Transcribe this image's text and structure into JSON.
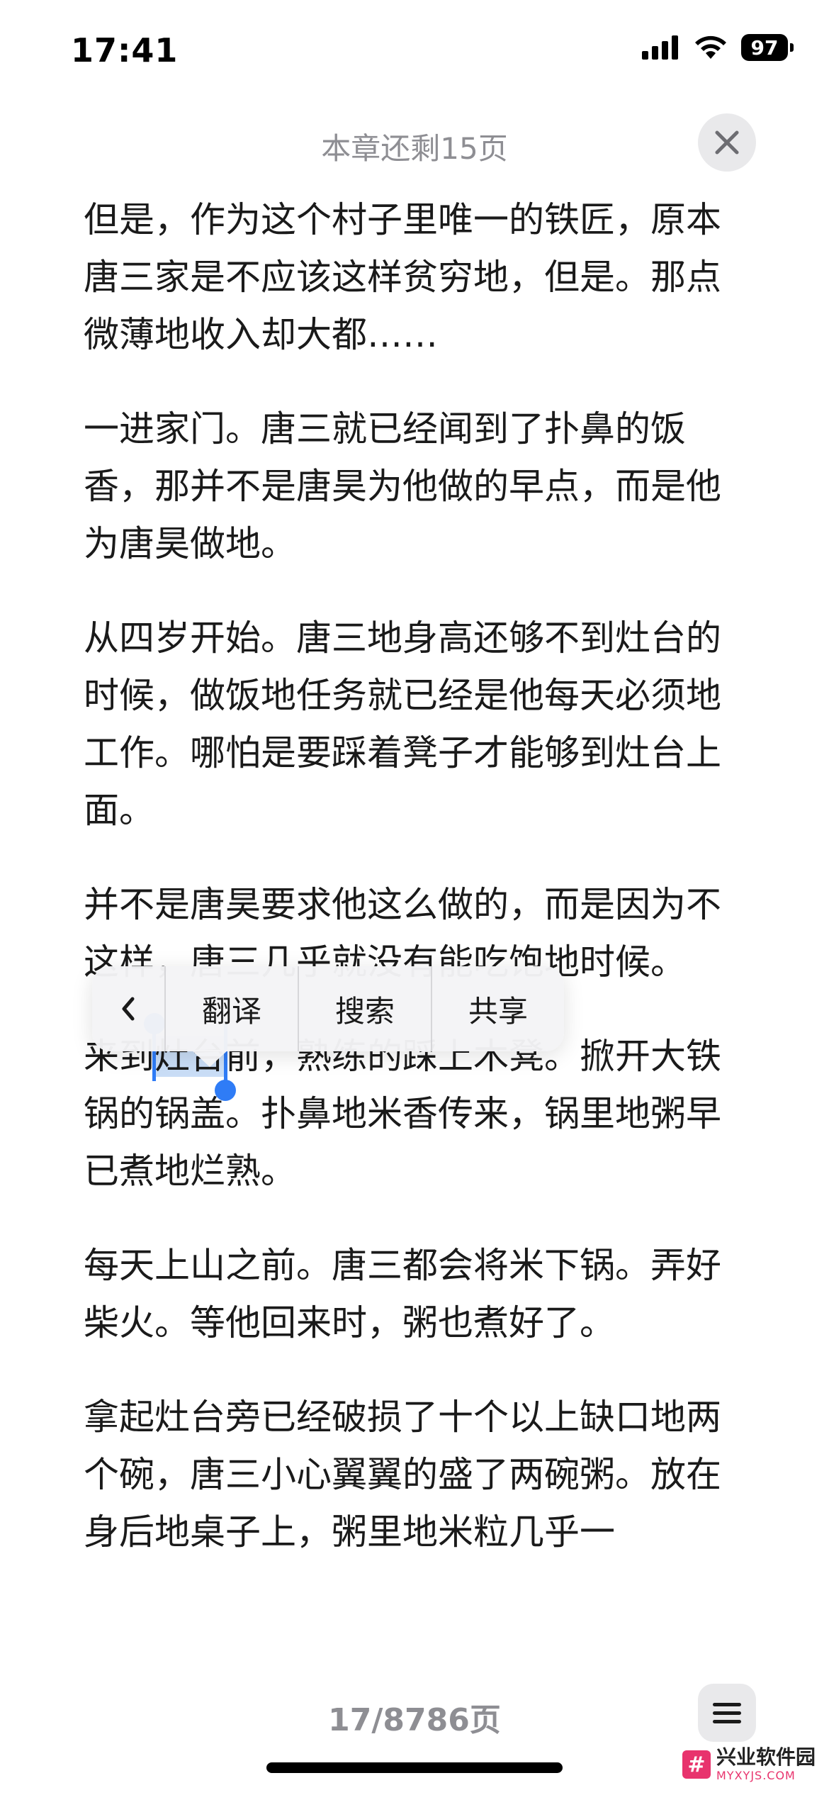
{
  "status_bar": {
    "time": "17:41",
    "battery": "97"
  },
  "header": {
    "chapter_remaining": "本章还剩15页"
  },
  "paragraphs": [
    "但是，作为这个村子里唯一的铁匠，原本唐三家是不应该这样贫穷地，但是。那点微薄地收入却大都……",
    "一进家门。唐三就已经闻到了扑鼻的饭香，那并不是唐昊为他做的早点，而是他为唐昊做地。",
    "从四岁开始。唐三地身高还够不到灶台的时候，做饭地任务就已经是他每天必须地工作。哪怕是要踩着凳子才能够到灶台上面。",
    "并不是唐昊要求他这么做的，而是因为不这样，唐三几乎就没有能吃饱地时候。"
  ],
  "selection_paragraph": {
    "before": "来到",
    "selected": "灶台",
    "after": "前，熟练的踩上木凳。掀开大铁锅的锅盖。扑鼻地米香传来，锅里地粥早已煮地烂熟。"
  },
  "paragraphs_after": [
    "每天上山之前。唐三都会将米下锅。弄好柴火。等他回来时，粥也煮好了。",
    "拿起灶台旁已经破损了十个以上缺口地两个碗，唐三小心翼翼的盛了两碗粥。放在身后地桌子上，粥里地米粒几乎一"
  ],
  "context_menu": {
    "items": [
      "翻译",
      "搜索",
      "共享"
    ]
  },
  "footer": {
    "page_counter": "17/8786页"
  },
  "watermark": {
    "logo": "#",
    "title": "兴业软件园",
    "subtitle": "MYXYJS.COM"
  },
  "colors": {
    "selection_handle": "#2f7cf6",
    "selection_highlight": "#c9ddf6",
    "secondary_text": "#8e8e93"
  }
}
